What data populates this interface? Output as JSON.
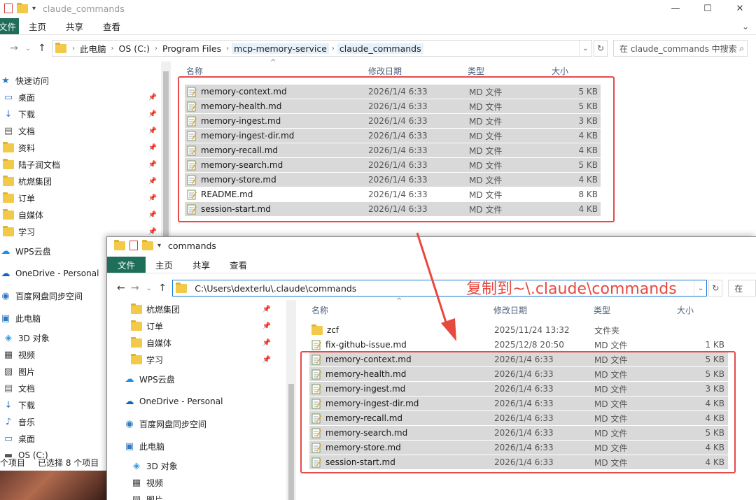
{
  "window_back": {
    "title": "claude_commands",
    "ribbon_tabs": [
      "文件",
      "主页",
      "共享",
      "查看"
    ],
    "breadcrumbs": [
      "此电脑",
      "OS (C:)",
      "Program Files",
      "mcp-memory-service",
      "claude_commands"
    ],
    "search_placeholder": "在 claude_commands 中搜索",
    "nav_items": [
      {
        "label": "快速访问",
        "icon": "star-icon"
      },
      {
        "label": "桌面",
        "icon": "desktop-icon",
        "pinned": true
      },
      {
        "label": "下载",
        "icon": "download-icon",
        "pinned": true
      },
      {
        "label": "文档",
        "icon": "document-icon",
        "pinned": true
      },
      {
        "label": "资料",
        "icon": "folder-icon",
        "pinned": true
      },
      {
        "label": "陆子润文档",
        "icon": "folder-icon",
        "pinned": true
      },
      {
        "label": "杭燃集团",
        "icon": "folder-icon",
        "pinned": true
      },
      {
        "label": "订单",
        "icon": "folder-icon",
        "pinned": true
      },
      {
        "label": "自媒体",
        "icon": "folder-icon",
        "pinned": true
      },
      {
        "label": "学习",
        "icon": "folder-icon",
        "pinned": true
      },
      {
        "label": "WPS云盘",
        "icon": "cloud-icon"
      },
      {
        "label": "OneDrive - Personal",
        "icon": "onedrive-icon"
      },
      {
        "label": "百度网盘同步空间",
        "icon": "baidu-icon"
      },
      {
        "label": "此电脑",
        "icon": "computer-icon"
      },
      {
        "label": "3D 对象",
        "icon": "3d-icon"
      },
      {
        "label": "视频",
        "icon": "video-icon"
      },
      {
        "label": "图片",
        "icon": "picture-icon"
      },
      {
        "label": "文档",
        "icon": "document-icon"
      },
      {
        "label": "下载",
        "icon": "download-icon"
      },
      {
        "label": "音乐",
        "icon": "music-icon"
      },
      {
        "label": "桌面",
        "icon": "desktop-icon"
      },
      {
        "label": "OS (C:)",
        "icon": "drive-icon"
      }
    ],
    "columns": [
      "名称",
      "修改日期",
      "类型",
      "大小"
    ],
    "files": [
      {
        "name": "memory-context.md",
        "date": "2026/1/4 6:33",
        "type": "MD 文件",
        "size": "5 KB",
        "selected": true
      },
      {
        "name": "memory-health.md",
        "date": "2026/1/4 6:33",
        "type": "MD 文件",
        "size": "5 KB",
        "selected": true
      },
      {
        "name": "memory-ingest.md",
        "date": "2026/1/4 6:33",
        "type": "MD 文件",
        "size": "3 KB",
        "selected": true
      },
      {
        "name": "memory-ingest-dir.md",
        "date": "2026/1/4 6:33",
        "type": "MD 文件",
        "size": "4 KB",
        "selected": true
      },
      {
        "name": "memory-recall.md",
        "date": "2026/1/4 6:33",
        "type": "MD 文件",
        "size": "4 KB",
        "selected": true
      },
      {
        "name": "memory-search.md",
        "date": "2026/1/4 6:33",
        "type": "MD 文件",
        "size": "5 KB",
        "selected": true
      },
      {
        "name": "memory-store.md",
        "date": "2026/1/4 6:33",
        "type": "MD 文件",
        "size": "4 KB",
        "selected": true
      },
      {
        "name": "README.md",
        "date": "2026/1/4 6:33",
        "type": "MD 文件",
        "size": "8 KB",
        "selected": false
      },
      {
        "name": "session-start.md",
        "date": "2026/1/4 6:33",
        "type": "MD 文件",
        "size": "4 KB",
        "selected": true
      }
    ],
    "status_items": "个项目",
    "status_selected": "已选择 8 个项目"
  },
  "window_front": {
    "title": "commands",
    "ribbon_tabs": [
      "文件",
      "主页",
      "共享",
      "查看"
    ],
    "address": "C:\\Users\\dexterlu\\.claude\\commands",
    "search_partial": "在",
    "nav_items": [
      {
        "label": "杭燃集团",
        "icon": "folder-icon",
        "pinned": true
      },
      {
        "label": "订单",
        "icon": "folder-icon",
        "pinned": true
      },
      {
        "label": "自媒体",
        "icon": "folder-icon",
        "pinned": true
      },
      {
        "label": "学习",
        "icon": "folder-icon",
        "pinned": true
      },
      {
        "label": "WPS云盘",
        "icon": "cloud-icon"
      },
      {
        "label": "OneDrive - Personal",
        "icon": "onedrive-icon"
      },
      {
        "label": "百度网盘同步空间",
        "icon": "baidu-icon"
      },
      {
        "label": "此电脑",
        "icon": "computer-icon"
      },
      {
        "label": "3D 对象",
        "icon": "3d-icon"
      },
      {
        "label": "视频",
        "icon": "video-icon"
      },
      {
        "label": "图片",
        "icon": "picture-icon"
      }
    ],
    "columns": [
      "名称",
      "修改日期",
      "类型",
      "大小"
    ],
    "files": [
      {
        "name": "zcf",
        "date": "2025/11/24 13:32",
        "type": "文件夹",
        "size": "",
        "folder": true,
        "selected": false
      },
      {
        "name": "fix-github-issue.md",
        "date": "2025/12/8 20:50",
        "type": "MD 文件",
        "size": "1 KB",
        "selected": false
      },
      {
        "name": "memory-context.md",
        "date": "2026/1/4 6:33",
        "type": "MD 文件",
        "size": "5 KB",
        "selected": true
      },
      {
        "name": "memory-health.md",
        "date": "2026/1/4 6:33",
        "type": "MD 文件",
        "size": "5 KB",
        "selected": true
      },
      {
        "name": "memory-ingest.md",
        "date": "2026/1/4 6:33",
        "type": "MD 文件",
        "size": "3 KB",
        "selected": true
      },
      {
        "name": "memory-ingest-dir.md",
        "date": "2026/1/4 6:33",
        "type": "MD 文件",
        "size": "4 KB",
        "selected": true
      },
      {
        "name": "memory-recall.md",
        "date": "2026/1/4 6:33",
        "type": "MD 文件",
        "size": "4 KB",
        "selected": true
      },
      {
        "name": "memory-search.md",
        "date": "2026/1/4 6:33",
        "type": "MD 文件",
        "size": "5 KB",
        "selected": true
      },
      {
        "name": "memory-store.md",
        "date": "2026/1/4 6:33",
        "type": "MD 文件",
        "size": "4 KB",
        "selected": true
      },
      {
        "name": "session-start.md",
        "date": "2026/1/4 6:33",
        "type": "MD 文件",
        "size": "4 KB",
        "selected": true
      }
    ]
  },
  "annotation": "复制到~\\.claude\\commands",
  "colors": {
    "file_tab": "#1e6e5a",
    "annotation_red": "#e8483e",
    "selection": "#d9d9d9",
    "folder": "#f3c94a"
  }
}
